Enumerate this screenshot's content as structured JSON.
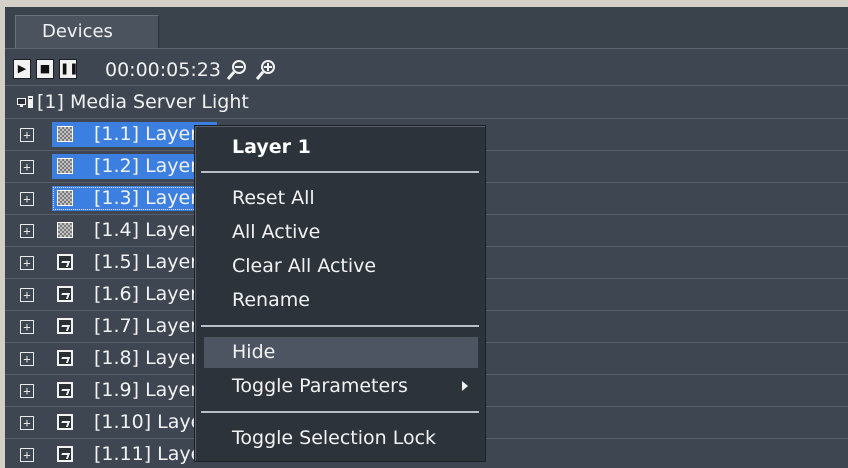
{
  "tabs": {
    "devices_label": "Devices"
  },
  "transport": {
    "timecode": "00:00:05:23",
    "play_icon": "play-icon",
    "stop_icon": "stop-icon",
    "pause_icon": "pause-icon",
    "zoom_out_icon": "zoom-out-icon",
    "zoom_in_icon": "zoom-in-icon"
  },
  "tree": {
    "server": {
      "label": "[1] Media Server Light",
      "icon": "computer-icon"
    },
    "layers": [
      {
        "label": "[1.1] Layer",
        "icon": "checker-icon",
        "selected": true
      },
      {
        "label": "[1.2] Layer",
        "icon": "checker-icon",
        "selected": true
      },
      {
        "label": "[1.3] Layer",
        "icon": "checker-icon",
        "selected": true,
        "focused": true
      },
      {
        "label": "[1.4] Layer",
        "icon": "checker-icon"
      },
      {
        "label": "[1.5] Layer",
        "icon": "image-icon"
      },
      {
        "label": "[1.6] Layer",
        "icon": "image-icon"
      },
      {
        "label": "[1.7] Layer",
        "icon": "image-icon"
      },
      {
        "label": "[1.8] Layer",
        "icon": "image-icon"
      },
      {
        "label": "[1.9] Layer",
        "icon": "image-icon"
      },
      {
        "label": "[1.10] Laye",
        "icon": "image-icon"
      },
      {
        "label": "[1.11] Laye",
        "icon": "image-icon"
      }
    ]
  },
  "context_menu": {
    "title": "Layer 1",
    "items": [
      {
        "label": "Reset All"
      },
      {
        "label": "All Active"
      },
      {
        "label": "Clear All Active"
      },
      {
        "label": "Rename"
      },
      {
        "label": "Hide",
        "highlighted": true
      },
      {
        "label": "Toggle Parameters",
        "has_submenu": true
      },
      {
        "label": "Toggle Selection Lock"
      }
    ]
  },
  "colors": {
    "panel_bg": "#3e4651",
    "selection": "#3b7fe0",
    "menu_bg": "#2d333b",
    "menu_hover": "#4d5562"
  }
}
